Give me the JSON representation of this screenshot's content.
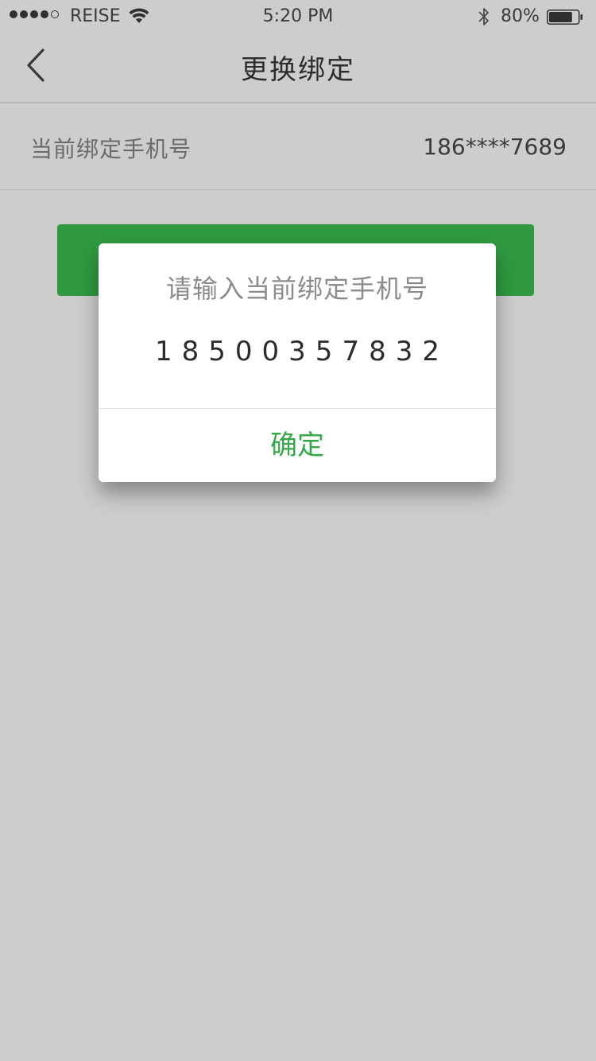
{
  "status_bar": {
    "carrier": "REISE",
    "time": "5:20 PM",
    "battery_percent": "80%",
    "signal_bars_filled": 4,
    "signal_bars_total": 5,
    "battery_level": 0.8
  },
  "nav": {
    "title": "更换绑定",
    "back_icon": "chevron-left-icon"
  },
  "phone_row": {
    "label": "当前绑定手机号",
    "value": "186****7689"
  },
  "dialog": {
    "title": "请输入当前绑定手机号",
    "input_value": "18500357832",
    "confirm_label": "确定"
  },
  "colors": {
    "background": "#cdcdcd",
    "primary_green": "#2f9a40",
    "confirm_text": "#35a848"
  }
}
